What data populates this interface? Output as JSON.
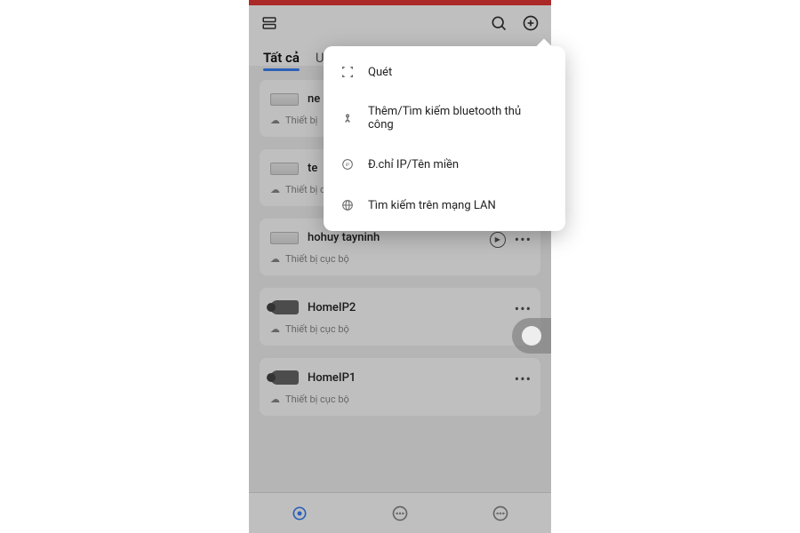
{
  "tabs": {
    "all": "Tất cả",
    "other": "U"
  },
  "devices": [
    {
      "name": "ne",
      "sub": "Thiết bị",
      "type": "nvr",
      "play": false
    },
    {
      "name": "te",
      "sub": "Thiết bị cục bộ",
      "type": "nvr",
      "play": false
    },
    {
      "name": "hohuy tayninh",
      "sub": "Thiết bị cục bộ",
      "type": "nvr",
      "play": true
    },
    {
      "name": "HomeIP2",
      "sub": "Thiết bị cục bộ",
      "type": "cam",
      "play": false
    },
    {
      "name": "HomeIP1",
      "sub": "Thiết bị cục bộ",
      "type": "cam",
      "play": false
    }
  ],
  "menu": {
    "scan": "Quét",
    "bluetooth": "Thêm/Tìm kiếm bluetooth thủ công",
    "ip": "Đ.chỉ IP/Tên miền",
    "lan": "Tìm kiếm trên mạng LAN"
  }
}
